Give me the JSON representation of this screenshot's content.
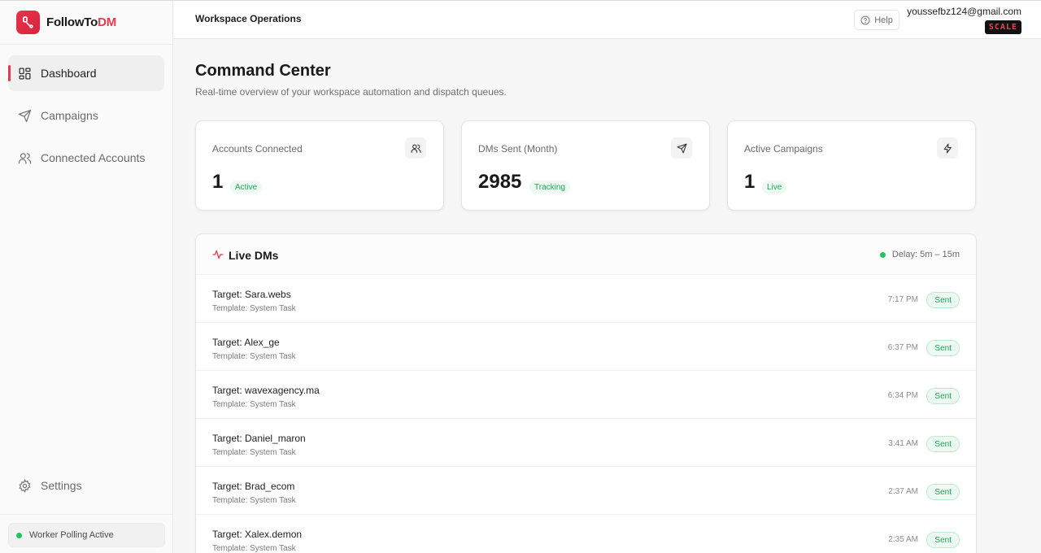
{
  "brand": {
    "name_main": "FollowTo",
    "name_accent": "DM"
  },
  "sidebar": {
    "items": [
      {
        "label": "Dashboard",
        "icon": "dashboard-grid-icon",
        "active": true
      },
      {
        "label": "Campaigns",
        "icon": "send-icon"
      },
      {
        "label": "Connected Accounts",
        "icon": "users-icon"
      }
    ],
    "settings_label": "Settings",
    "worker_status": "Worker Polling Active"
  },
  "topbar": {
    "title": "Workspace Operations",
    "help_label": "Help",
    "email": "youssefbz124@gmail.com",
    "plan": "SCALE"
  },
  "page": {
    "title": "Command Center",
    "subtitle": "Real-time overview of your workspace automation and dispatch queues."
  },
  "cards": [
    {
      "label": "Accounts Connected",
      "value": "1",
      "badge": "Active",
      "icon": "users-icon"
    },
    {
      "label": "DMs Sent (Month)",
      "value": "2985",
      "badge": "Tracking",
      "icon": "send-icon"
    },
    {
      "label": "Active Campaigns",
      "value": "1",
      "badge": "Live",
      "icon": "zap-icon"
    }
  ],
  "live": {
    "title": "Live DMs",
    "delay": "Delay: 5m – 15m",
    "rows": [
      {
        "target": "Target: Sara.webs",
        "template": "Template: System Task",
        "time": "7:17 PM",
        "status": "Sent"
      },
      {
        "target": "Target: Alex_ge",
        "template": "Template: System Task",
        "time": "6:37 PM",
        "status": "Sent"
      },
      {
        "target": "Target: wavexagency.ma",
        "template": "Template: System Task",
        "time": "6:34 PM",
        "status": "Sent"
      },
      {
        "target": "Target: Daniel_maron",
        "template": "Template: System Task",
        "time": "3:41 AM",
        "status": "Sent"
      },
      {
        "target": "Target: Brad_ecom",
        "template": "Template: System Task",
        "time": "2:37 AM",
        "status": "Sent"
      },
      {
        "target": "Target: Xalex.demon",
        "template": "Template: System Task",
        "time": "2:35 AM",
        "status": "Sent"
      }
    ]
  },
  "colors": {
    "accent": "#e23a4f",
    "success": "#22c55e",
    "success_text": "#22a05a"
  }
}
